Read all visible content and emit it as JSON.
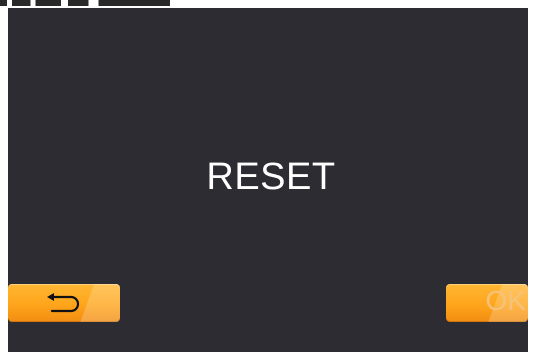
{
  "screen": {
    "message": "RESET"
  },
  "buttons": {
    "back_icon": "return-arrow-icon",
    "ok_label": "OK"
  },
  "colors": {
    "background": "#2e2c33",
    "button_orange": "#ffa51b",
    "text": "#ffffff"
  }
}
